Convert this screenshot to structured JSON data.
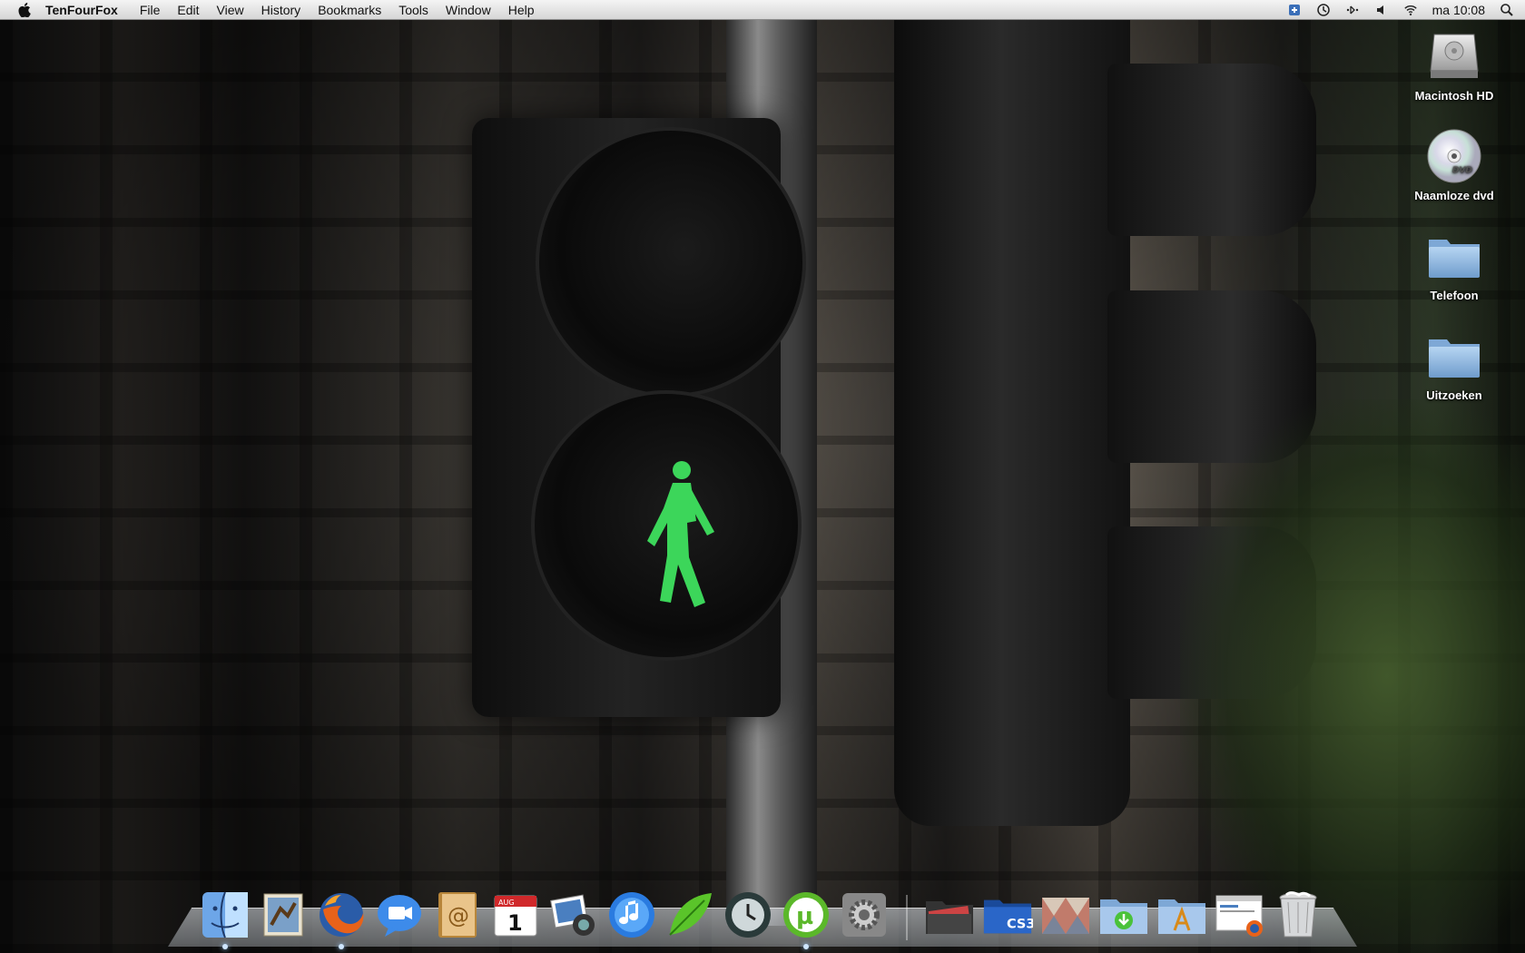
{
  "menubar": {
    "app_name": "TenFourFox",
    "items": [
      "File",
      "Edit",
      "View",
      "History",
      "Bookmarks",
      "Tools",
      "Window",
      "Help"
    ],
    "clock": "ma 10:08"
  },
  "desktop": {
    "icons": [
      {
        "label": "Macintosh HD",
        "icon": "hard-drive-icon"
      },
      {
        "label": "Naamloze dvd",
        "icon": "dvd-icon"
      },
      {
        "label": "Telefoon",
        "icon": "folder-icon"
      },
      {
        "label": "Uitzoeken",
        "icon": "folder-icon"
      }
    ]
  },
  "dock": {
    "apps": [
      {
        "name": "finder-icon"
      },
      {
        "name": "mail-icon"
      },
      {
        "name": "firefox-icon"
      },
      {
        "name": "ichat-icon"
      },
      {
        "name": "address-book-icon"
      },
      {
        "name": "ical-icon",
        "month": "AUG",
        "day": "1"
      },
      {
        "name": "iphoto-icon"
      },
      {
        "name": "itunes-icon"
      },
      {
        "name": "leaf-app-icon"
      },
      {
        "name": "time-machine-icon"
      },
      {
        "name": "utorrent-icon"
      },
      {
        "name": "system-preferences-icon"
      }
    ],
    "stacks": [
      {
        "name": "documents-stack-icon"
      },
      {
        "name": "cs3-folder-icon",
        "label": "CS3"
      },
      {
        "name": "pictures-stack-icon"
      },
      {
        "name": "downloads-folder-icon"
      },
      {
        "name": "applications-folder-icon"
      },
      {
        "name": "firefox-window-icon"
      },
      {
        "name": "trash-icon"
      }
    ]
  }
}
